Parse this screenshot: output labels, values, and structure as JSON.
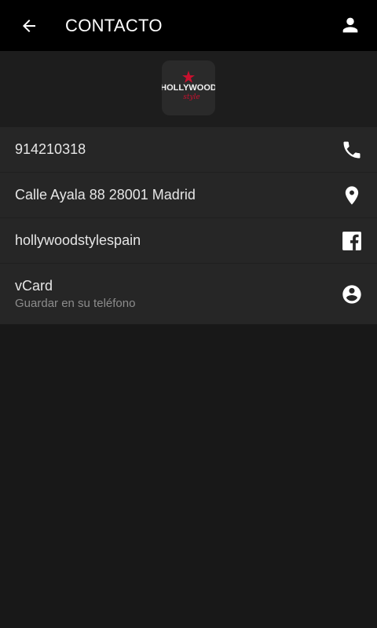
{
  "topbar": {
    "title": "CONTACTO",
    "back_icon": "arrow-left-icon",
    "profile_icon": "person-icon"
  },
  "logo": {
    "text": "HOLLYWOOD",
    "script": "style"
  },
  "contacts": [
    {
      "primary": "914210318",
      "icon": "phone-icon"
    },
    {
      "primary": "Calle Ayala 88 28001 Madrid",
      "icon": "location-pin-icon"
    },
    {
      "primary": "hollywoodstylespain",
      "icon": "facebook-icon"
    },
    {
      "primary": "vCard",
      "secondary": "Guardar en su teléfono",
      "icon": "account-circle-icon"
    }
  ],
  "colors": {
    "topbar": "#000000",
    "background": "#181818",
    "list": "#262626",
    "logo_accent": "#c8102e"
  }
}
